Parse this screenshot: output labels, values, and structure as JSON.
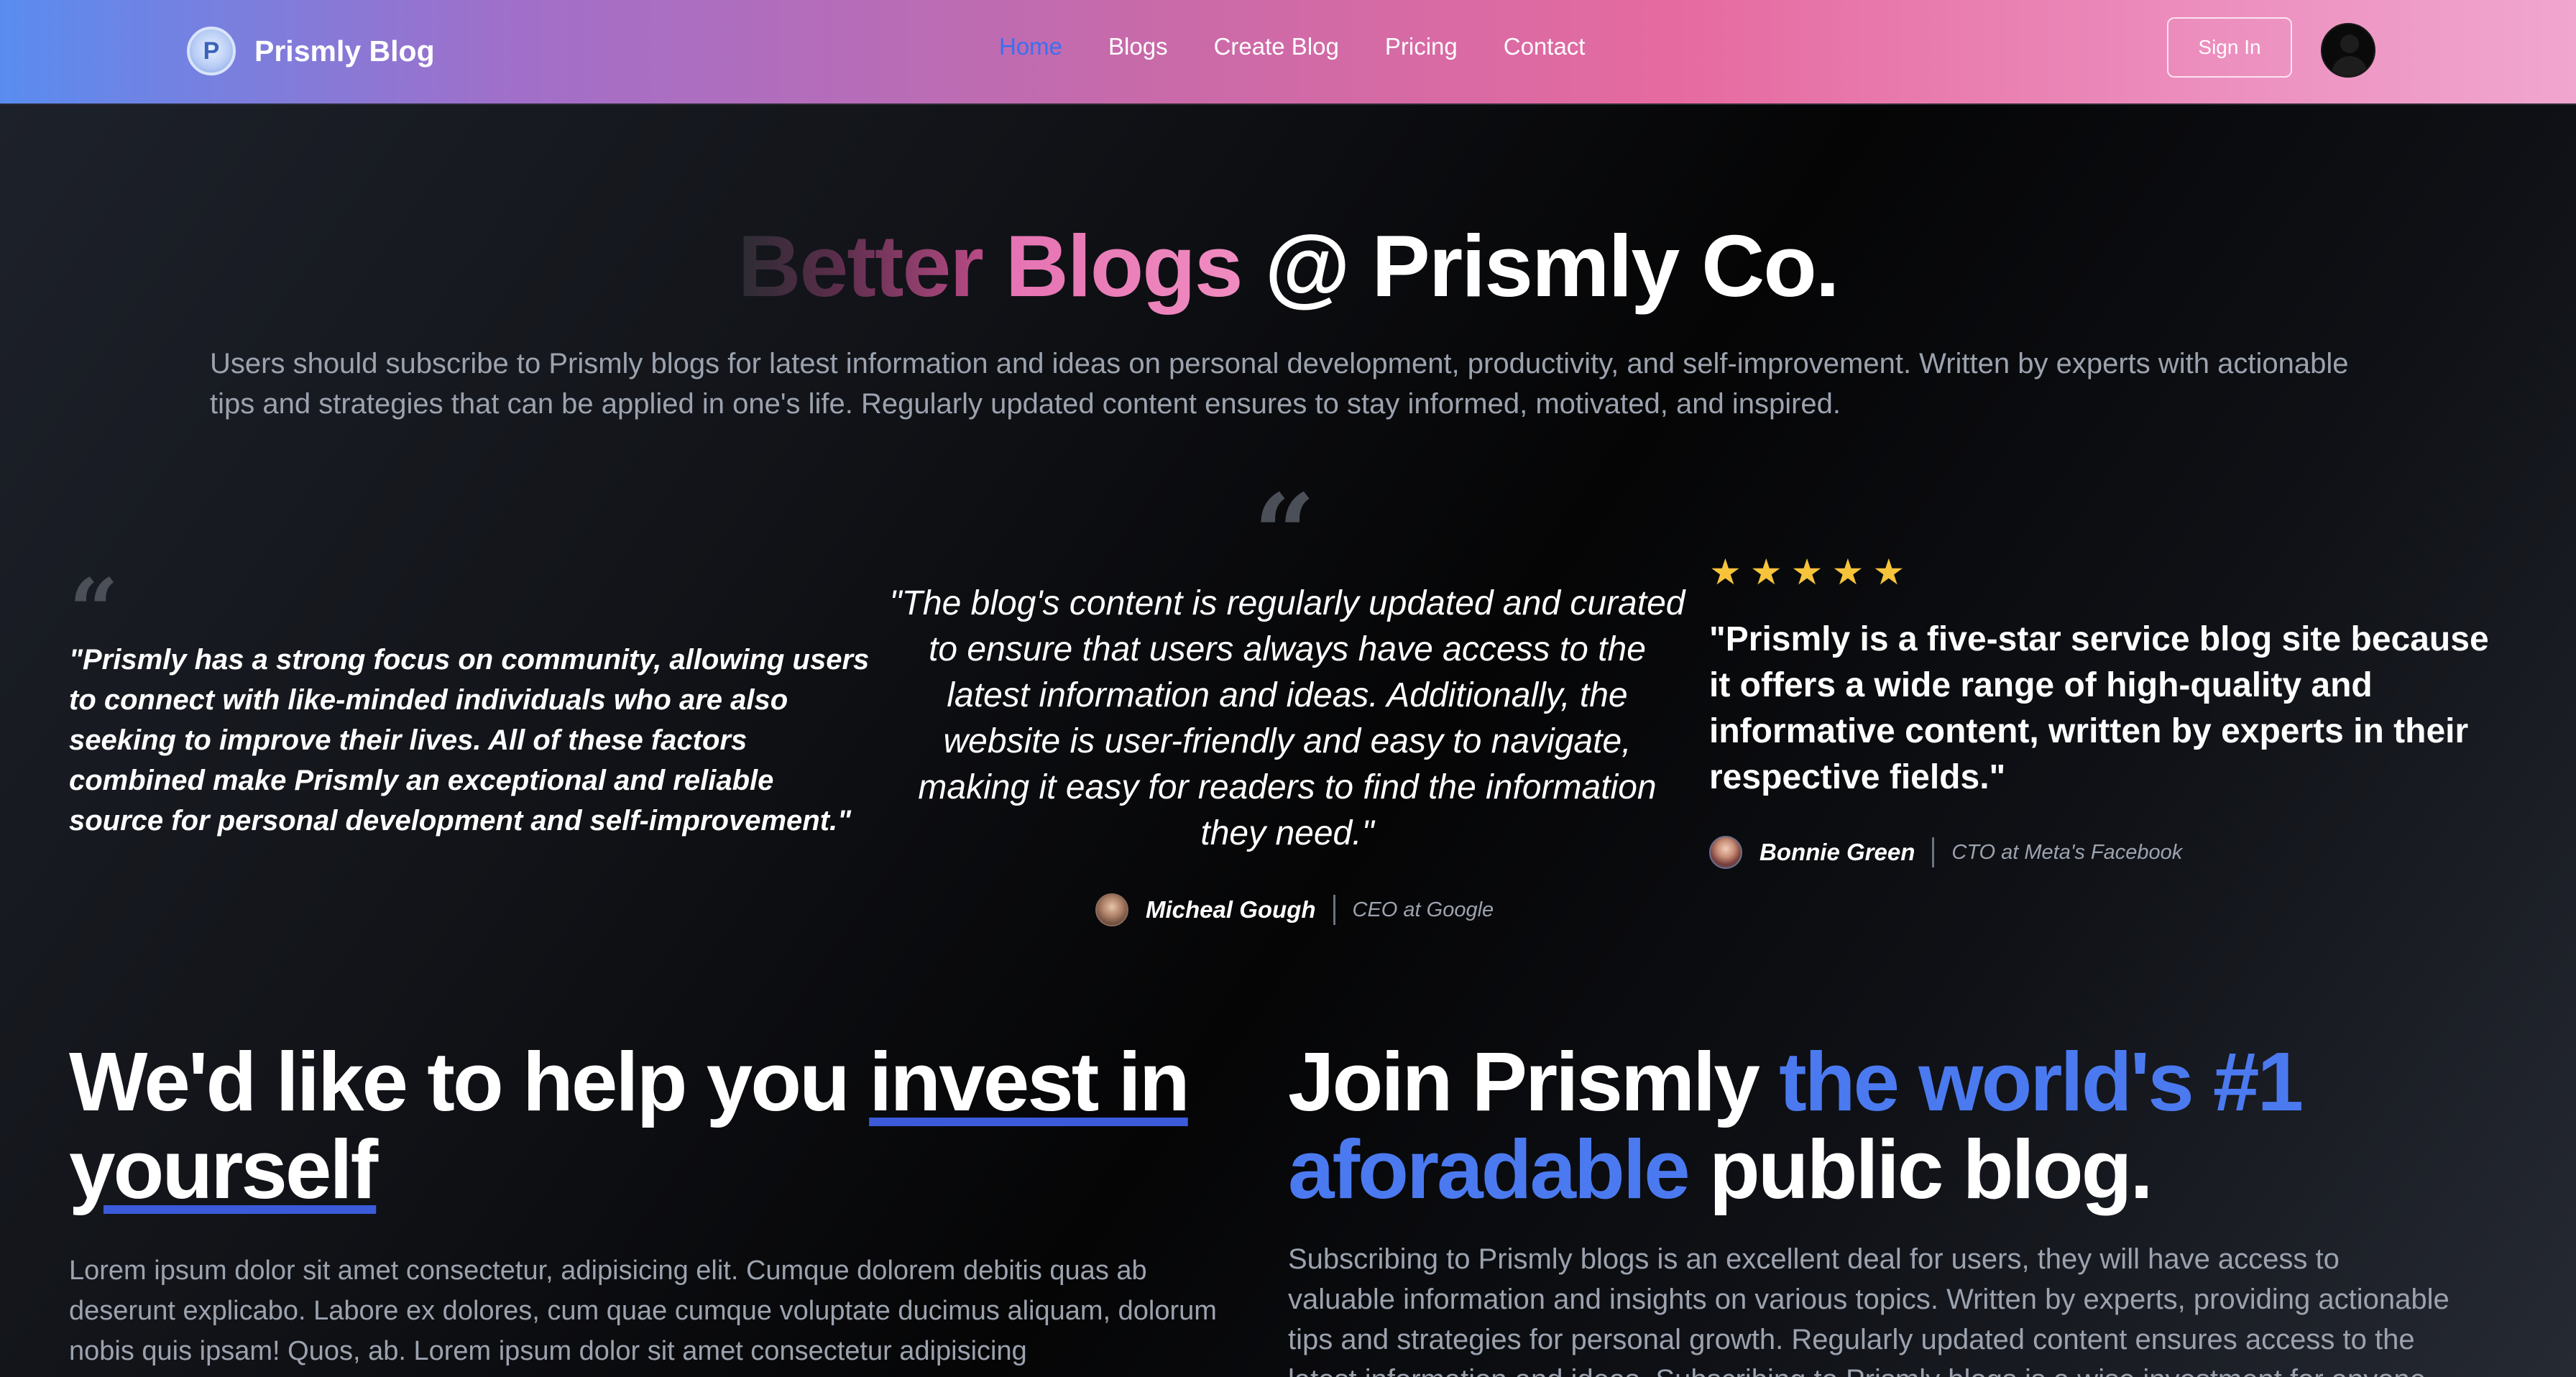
{
  "nav": {
    "brand_initial": "P",
    "brand_name": "Prismly Blog",
    "links": [
      "Home",
      "Blogs",
      "Create Blog",
      "Pricing",
      "Contact"
    ],
    "active_link": "Home",
    "signin_label": "Sign In"
  },
  "hero": {
    "title_part1": "Better",
    "title_part2": "Blogs",
    "title_part3": "@ Prismly Co.",
    "subtitle": "Users should subscribe to Prismly blogs for latest information and ideas on personal development, productivity, and self-improvement. Written by experts with actionable tips and strategies that can be applied in one's life. Regularly updated content ensures to stay informed, motivated, and inspired."
  },
  "testimonials": {
    "left": {
      "quote": "\"Prismly has a strong focus on community, allowing users to connect with like-minded individuals who are also seeking to improve their lives. All of these factors combined make Prismly an exceptional and reliable source for personal development and self-improvement.\""
    },
    "middle": {
      "quote": "\"The blog's content is regularly updated and curated to ensure that users always have access to the latest information and ideas. Additionally, the website is user-friendly and easy to navigate, making it easy for readers to find the information they need.\"",
      "author_name": "Micheal Gough",
      "author_role": "CEO at Google"
    },
    "right": {
      "rating": 5,
      "quote": "\"Prismly is a five-star service blog site because it offers a wide range of high-quality and informative content, written by experts in their respective fields.\"",
      "author_name": "Bonnie Green",
      "author_role": "CTO at Meta's Facebook"
    },
    "quote_glyph": "“",
    "star_glyph": "★",
    "star_color": "#f6c33b"
  },
  "invest": {
    "heading_plain": "We'd like to help you",
    "heading_underlined": "invest in yourself",
    "body": "Lorem ipsum dolor sit amet consectetur, adipisicing elit. Cumque dolorem debitis quas ab deserunt explicabo. Labore ex dolores, cum quae cumque voluptate ducimus aliquam, dolorum nobis quis ipsam! Quos, ab. Lorem ipsum dolor sit amet consectetur adipisicing"
  },
  "join": {
    "heading_start": "Join Prismly",
    "heading_highlight": "the world's #1 aforadable",
    "heading_end": "public blog.",
    "body": "Subscribing to Prismly blogs is an excellent deal for users, they will have access to valuable information and insights on various topics. Written by experts, providing actionable tips and strategies for personal growth. Regularly updated content ensures access to the latest information and ideas. Subscribing to Prismly blogs is a wise investment for anyone looking to"
  },
  "colors": {
    "accent_blue": "#4b7af0",
    "active_nav": "#3b6ff0",
    "underline": "#3b5bdb",
    "muted_text": "#9ca3af"
  }
}
